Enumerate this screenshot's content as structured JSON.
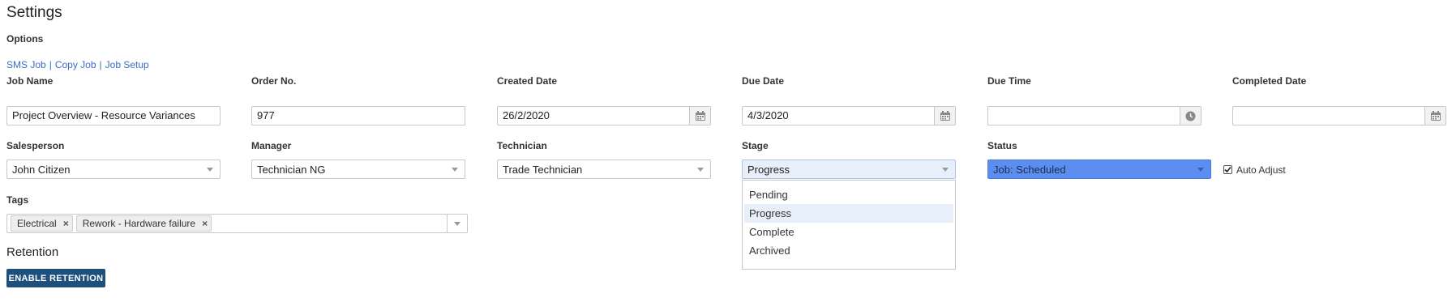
{
  "page": {
    "title": "Settings"
  },
  "options": {
    "label": "Options",
    "links": [
      "SMS Job",
      "Copy Job",
      "Job Setup"
    ],
    "separator": "|"
  },
  "row1": {
    "job_name": {
      "label": "Job Name",
      "value": "Project Overview - Resource Variances"
    },
    "order_no": {
      "label": "Order No.",
      "value": "977"
    },
    "created_date": {
      "label": "Created Date",
      "value": "26/2/2020"
    },
    "due_date": {
      "label": "Due Date",
      "value": "4/3/2020"
    },
    "due_time": {
      "label": "Due Time",
      "value": ""
    },
    "completed_date": {
      "label": "Completed Date",
      "value": ""
    }
  },
  "row2": {
    "salesperson": {
      "label": "Salesperson",
      "value": "John Citizen"
    },
    "manager": {
      "label": "Manager",
      "value": "Technician NG"
    },
    "technician": {
      "label": "Technician",
      "value": "Trade Technician"
    },
    "stage": {
      "label": "Stage",
      "value": "Progress",
      "options": [
        "Pending",
        "Progress",
        "Complete",
        "Archived"
      ],
      "highlighted": "Progress"
    },
    "status": {
      "label": "Status",
      "value": "Job: Scheduled",
      "color": "#5b8ef0"
    },
    "auto_adjust": {
      "label": "Auto Adjust",
      "checked": true
    }
  },
  "tags": {
    "label": "Tags",
    "items": [
      "Electrical",
      "Rework - Hardware failure"
    ],
    "remove_glyph": "×"
  },
  "retention": {
    "title": "Retention",
    "button_label": "ENABLE RETENTION",
    "button_color": "#1e4f7d"
  },
  "icons": {
    "calendar": "calendar-icon",
    "clock": "clock-icon",
    "caret": "chevron-down-icon",
    "check": "check-icon"
  },
  "colors": {
    "link": "#3a6fc4",
    "selected_option": "#e6effa"
  }
}
